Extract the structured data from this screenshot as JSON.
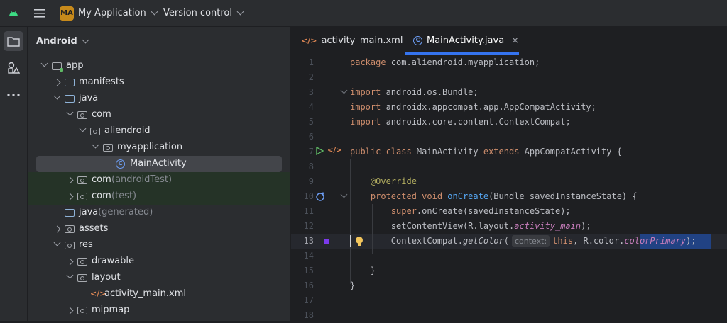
{
  "titlebar": {
    "project_badge": "MA",
    "project_name": "My Application",
    "vcs_label": "Version control"
  },
  "project_panel": {
    "view_label": "Android",
    "tree": [
      {
        "label": "app",
        "suffix": "",
        "level": 0,
        "arrow": "down",
        "icon": "module-folder-icon"
      },
      {
        "label": "manifests",
        "suffix": "",
        "level": 1,
        "arrow": "right",
        "icon": "folder-icon"
      },
      {
        "label": "java",
        "suffix": "",
        "level": 1,
        "arrow": "down",
        "icon": "folder-icon"
      },
      {
        "label": "com",
        "suffix": "",
        "level": 2,
        "arrow": "down",
        "icon": "package-icon"
      },
      {
        "label": "aliendroid",
        "suffix": "",
        "level": 3,
        "arrow": "down",
        "icon": "package-icon"
      },
      {
        "label": "myapplication",
        "suffix": "",
        "level": 4,
        "arrow": "down",
        "icon": "package-icon"
      },
      {
        "label": "MainActivity",
        "suffix": "",
        "level": 5,
        "arrow": "none",
        "icon": "class-icon",
        "selected": true
      },
      {
        "label": "com",
        "suffix": " (androidTest)",
        "level": 2,
        "arrow": "right",
        "icon": "package-icon",
        "green": true
      },
      {
        "label": "com",
        "suffix": " (test)",
        "level": 2,
        "arrow": "right",
        "icon": "package-icon",
        "green": true
      },
      {
        "label": "java",
        "suffix": " (generated)",
        "level": 1,
        "arrow": "none",
        "icon": "folder-icon"
      },
      {
        "label": "assets",
        "suffix": "",
        "level": 1,
        "arrow": "right",
        "icon": "resource-folder-icon"
      },
      {
        "label": "res",
        "suffix": "",
        "level": 1,
        "arrow": "down",
        "icon": "resource-folder-icon"
      },
      {
        "label": "drawable",
        "suffix": "",
        "level": 2,
        "arrow": "right",
        "icon": "package-icon"
      },
      {
        "label": "layout",
        "suffix": "",
        "level": 2,
        "arrow": "down",
        "icon": "package-icon"
      },
      {
        "label": "activity_main.xml",
        "suffix": "",
        "level": 3,
        "arrow": "none",
        "icon": "xml-file-icon"
      },
      {
        "label": "mipmap",
        "suffix": "",
        "level": 2,
        "arrow": "right",
        "icon": "package-icon"
      }
    ]
  },
  "editor": {
    "tabs": [
      {
        "label": "activity_main.xml",
        "icon": "xml-file-icon",
        "active": false
      },
      {
        "label": "MainActivity.java",
        "icon": "class-icon",
        "active": true
      }
    ],
    "current_line": 13,
    "line_numbers": [
      "1",
      "2",
      "3",
      "4",
      "5",
      "6",
      "7",
      "8",
      "9",
      "10",
      "11",
      "12",
      "13",
      "14",
      "15",
      "16",
      "17",
      "18"
    ],
    "inlay_hint": "context:",
    "code": {
      "l1a": "package",
      "l1b": " com.aliendroid.myapplication;",
      "l3a": "import",
      "l3b": " android.os.Bundle;",
      "l4a": "import",
      "l4b": " androidx.appcompat.app.AppCompatActivity;",
      "l5a": "import",
      "l5b": " androidx.core.content.ContextCompat;",
      "l7a": "public class",
      "l7b": " MainActivity ",
      "l7c": "extends",
      "l7d": " AppCompatActivity {",
      "l9": "    @Override",
      "l10a": "    protected void",
      "l10b": " onCreate",
      "l10c": "(Bundle savedInstanceState) {",
      "l11a": "        super",
      "l11b": ".onCreate(savedInstanceState);",
      "l12a": "        setContentView(R.layout.",
      "l12b": "activity_main",
      "l12c": ");",
      "l13a": "        ContextCompat.",
      "l13b": "getColor",
      "l13c": "(",
      "l13d": "this",
      "l13e": ", R.color.",
      "l13f": "colorPrimary",
      "l13g": ");",
      "l15": "    }",
      "l16": "}"
    }
  },
  "colors": {
    "background": "#1e1f22",
    "panel": "#2b2d30",
    "accent": "#3574f0",
    "keyword": "#cf8e6d",
    "field": "#c77dbb",
    "function": "#56a8f5",
    "annotation": "#b3ae60"
  }
}
